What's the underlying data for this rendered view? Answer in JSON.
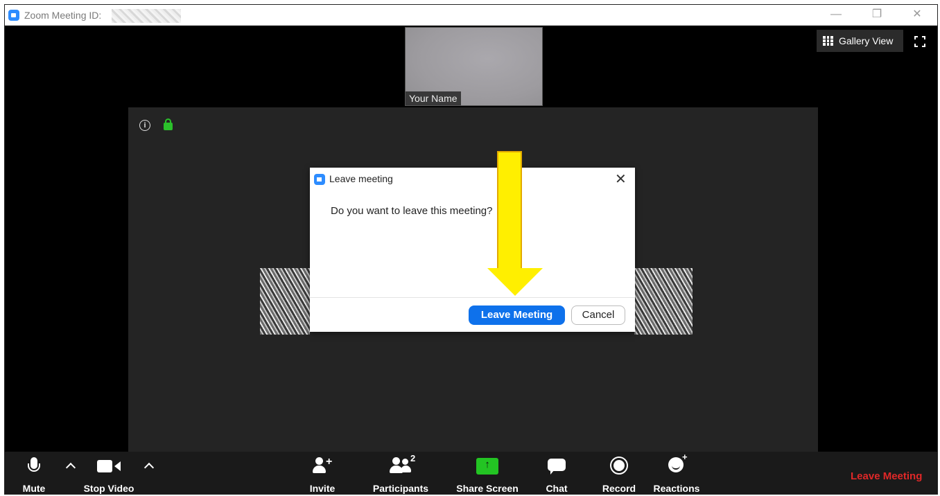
{
  "window": {
    "title": "Zoom Meeting ID:",
    "controls": [
      "—",
      "❐",
      "✕"
    ]
  },
  "header": {
    "gallery_view_label": "Gallery View"
  },
  "self_video": {
    "name": "Your Name"
  },
  "stage": {
    "info_glyph": "i"
  },
  "dialog": {
    "title": "Leave meeting",
    "close_glyph": "✕",
    "message": "Do you want to leave this meeting?",
    "leave_button": "Leave Meeting",
    "cancel_button": "Cancel"
  },
  "toolbar": {
    "mute": "Mute",
    "stop_video": "Stop Video",
    "invite": "Invite",
    "participants": "Participants",
    "participant_count": "2",
    "share_screen": "Share Screen",
    "chat": "Chat",
    "record": "Record",
    "reactions": "Reactions",
    "leave_meeting": "Leave Meeting"
  },
  "colors": {
    "zoom_blue": "#0e71eb",
    "leave_red": "#e02828",
    "share_green": "#23c423",
    "annotation_yellow": "#ffef00"
  }
}
